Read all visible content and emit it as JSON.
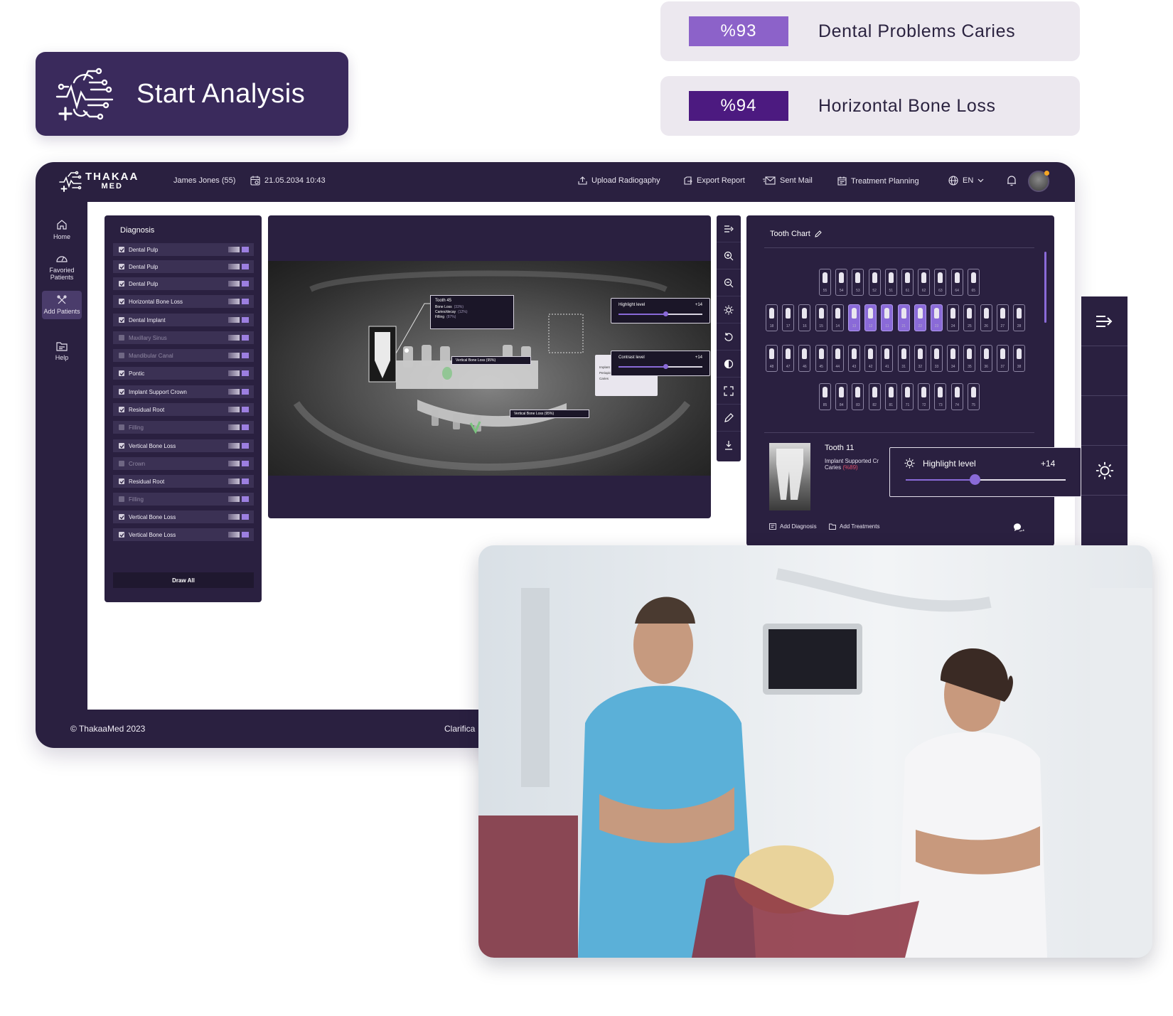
{
  "start_analysis": {
    "label": "Start Analysis"
  },
  "stats": [
    {
      "value": "%93",
      "label": "Dental Problems Caries",
      "color": "#8c62c9"
    },
    {
      "value": "%94",
      "label": "Horizontal Bone Loss",
      "color": "#4c1a80"
    }
  ],
  "header": {
    "logo_line1": "THAKAA",
    "logo_line2": "MED",
    "patient": "James Jones (55)",
    "datetime": "21.05.2034 10:43",
    "actions": [
      "Upload Radiogaphy",
      "Export Report",
      "Sent Mail",
      "Treatment Planning"
    ],
    "language": "EN"
  },
  "sidebar": {
    "items": [
      {
        "label": "Home",
        "icon": "home-icon"
      },
      {
        "label": "Favoried Patients",
        "icon": "gauge-icon"
      },
      {
        "label": "Add Patients",
        "icon": "tools-icon"
      },
      {
        "label": "Help",
        "icon": "help-folder-icon"
      }
    ]
  },
  "diagnosis": {
    "title": "Diagnosis",
    "items": [
      {
        "label": "Dental Pulp",
        "checked": true
      },
      {
        "label": "Dental Pulp",
        "checked": true
      },
      {
        "label": "Dental Pulp",
        "checked": true
      },
      {
        "label": "Horizontal Bone Loss",
        "checked": true
      },
      {
        "label": "Dental Implant",
        "checked": true
      },
      {
        "label": "Maxillary Sinus",
        "checked": false
      },
      {
        "label": "Mandibular Canal",
        "checked": false
      },
      {
        "label": "Pontic",
        "checked": true
      },
      {
        "label": "Implant Support Crown",
        "checked": true
      },
      {
        "label": "Residual Root",
        "checked": true
      },
      {
        "label": "Filling",
        "checked": false
      },
      {
        "label": "Vertical Bone Loss",
        "checked": true
      },
      {
        "label": "Crown",
        "checked": false
      },
      {
        "label": "Residual Root",
        "checked": true
      },
      {
        "label": "Filling",
        "checked": false
      },
      {
        "label": "Vertical Bone Loss",
        "checked": true
      },
      {
        "label": "Vertical Bone Loss",
        "checked": true
      }
    ],
    "draw_all": "Draw All"
  },
  "xray": {
    "tooth_card": {
      "title": "Tooth 45",
      "lines": [
        {
          "label": "Bone Loss",
          "pct": "(33%)"
        },
        {
          "label": "Caries/decay",
          "pct": "(12%)"
        },
        {
          "label": "Filling",
          "pct": "(87%)"
        }
      ]
    },
    "vbl_label_1": "Vertical Bone Loss (95%)",
    "vbl_label_2": "Vertical Bone Loss (95%)",
    "highlight": {
      "label": "Highlight level",
      "value": "+14",
      "level": 0.55
    },
    "contrast": {
      "label": "Contrast level",
      "value": "+14",
      "level": 0.55
    },
    "legend": [
      "Implant",
      "Periapical R.",
      "Caries"
    ]
  },
  "tooth_chart": {
    "title": "Tooth Chart",
    "row1": [
      "55",
      "54",
      "53",
      "52",
      "51",
      "61",
      "62",
      "63",
      "64",
      "65"
    ],
    "row2": [
      "18",
      "17",
      "16",
      "15",
      "14",
      "13",
      "12",
      "11",
      "21",
      "22",
      "23",
      "24",
      "25",
      "26",
      "27",
      "28"
    ],
    "row2_selected": [
      "13",
      "12",
      "11",
      "21",
      "22",
      "23"
    ],
    "row3": [
      "48",
      "47",
      "46",
      "45",
      "44",
      "43",
      "42",
      "41",
      "31",
      "32",
      "33",
      "34",
      "35",
      "36",
      "37",
      "38"
    ],
    "row4": [
      "85",
      "84",
      "83",
      "82",
      "81",
      "71",
      "72",
      "73",
      "74",
      "75"
    ],
    "selected_tooth": {
      "title": "Tooth 11",
      "line1": "Implant Supported Cr",
      "line2": "Caries",
      "line2_pct": "(%89)"
    },
    "add_diagnosis": "Add Diagnosis",
    "add_treatments": "Add Treatments"
  },
  "highlight_big": {
    "label": "Highlight level",
    "value": "+14",
    "level": 0.42
  },
  "footer": {
    "copyright": "© ThakaaMed 2023",
    "right_text": "Clarifica"
  },
  "colors": {
    "primary_dark": "#2a2040",
    "accent": "#8a6ad8",
    "brand": "#3a2a5c"
  }
}
